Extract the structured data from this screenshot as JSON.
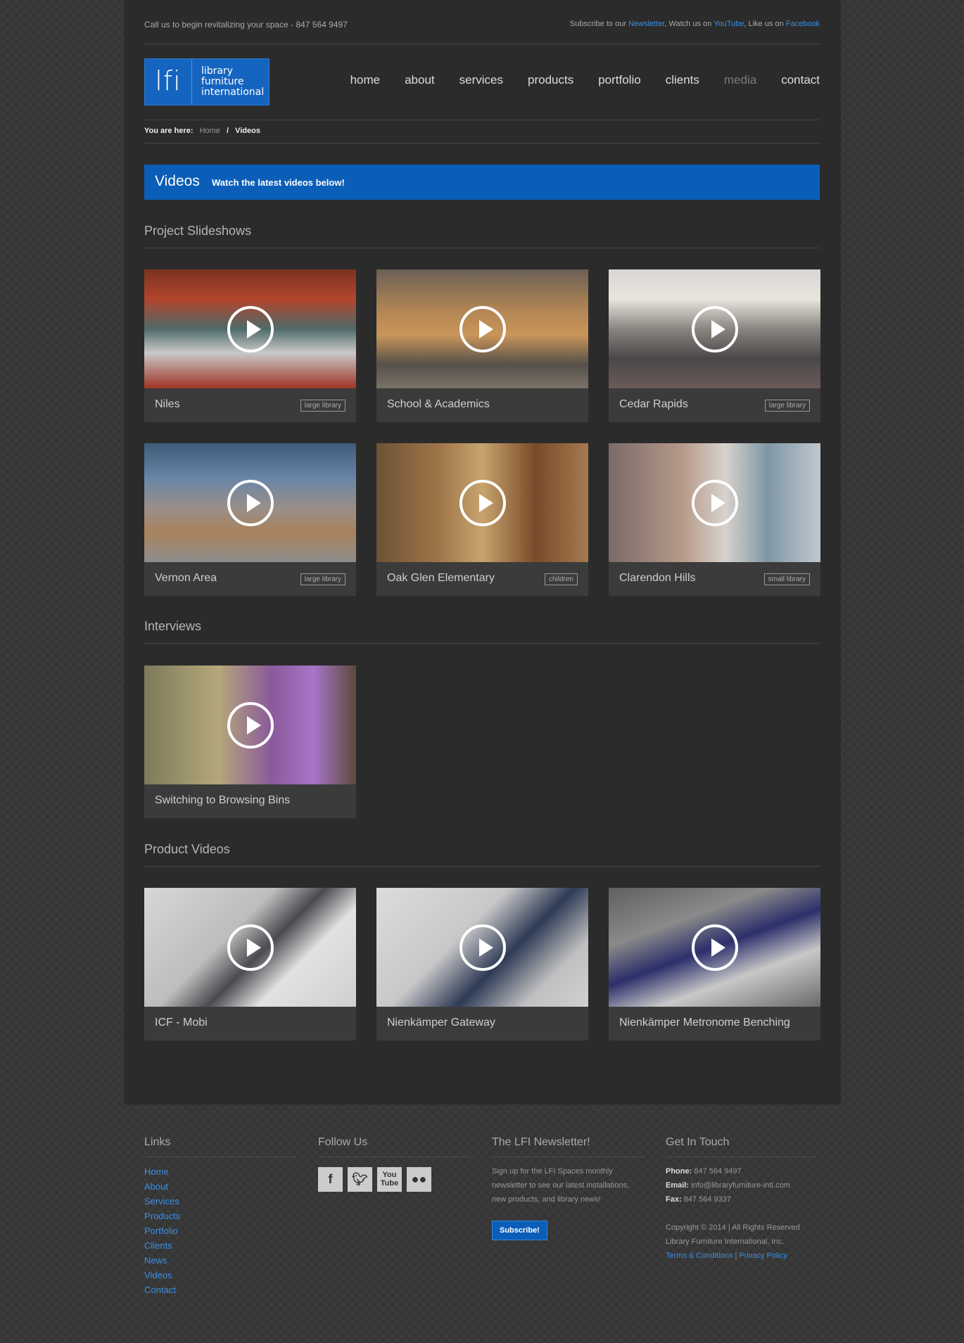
{
  "topbar": {
    "call": "Call us to begin revitalizing your space - 847 564 9497",
    "subscribe_prefix": "Subscribe to our",
    "newsletter": "Newsletter",
    "watch_prefix": ", Watch us on",
    "youtube": "YouTube",
    "like_prefix": ", Like us on",
    "facebook": "Facebook"
  },
  "logo": {
    "mark": "lfi",
    "line1": "library",
    "line2": "furniture",
    "line3": "international"
  },
  "nav": [
    "home",
    "about",
    "services",
    "products",
    "portfolio",
    "clients",
    "media",
    "contact"
  ],
  "breadcrumb": {
    "prefix": "You are here:",
    "home": "Home",
    "sep": "/",
    "current": "Videos"
  },
  "banner": {
    "title": "Videos",
    "subtitle": "Watch the latest videos below!"
  },
  "sections": {
    "slideshows": "Project Slideshows",
    "interviews": "Interviews",
    "products": "Product Videos"
  },
  "slideshows": [
    {
      "title": "Niles",
      "tag": "large library"
    },
    {
      "title": "School & Academics",
      "tag": ""
    },
    {
      "title": "Cedar Rapids",
      "tag": "large library"
    },
    {
      "title": "Vernon Area",
      "tag": "large library"
    },
    {
      "title": "Oak Glen Elementary",
      "tag": "children"
    },
    {
      "title": "Clarendon Hills",
      "tag": "small library"
    }
  ],
  "interviews": [
    {
      "title": "Switching to Browsing Bins"
    }
  ],
  "product_videos": [
    {
      "title": "ICF - Mobi"
    },
    {
      "title": "Nienkämper Gateway"
    },
    {
      "title": "Nienkämper Metronome Benching"
    }
  ],
  "footer": {
    "links_title": "Links",
    "links": [
      "Home",
      "About",
      "Services",
      "Products",
      "Portfolio",
      "Clients",
      "News",
      "Videos",
      "Contact"
    ],
    "follow_title": "Follow Us",
    "newsletter_title": "The LFI Newsletter!",
    "newsletter_text": "Sign up for the LFI Spaces monthly newsletter to see our latest installations, new products, and library news!",
    "subscribe_button": "Subscribe!",
    "contact_title": "Get In Touch",
    "phone_label": "Phone:",
    "phone": "847 564 9497",
    "email_label": "Email:",
    "email": "info@libraryfurniture-intl.com",
    "fax_label": "Fax:",
    "fax": "847 564 9337",
    "copyright": "Copyright © 2014 | All Rights Reserved",
    "company": "Library Furniture International, Inc.",
    "terms": "Terms & Conditions",
    "sep": "|",
    "privacy": "Privacy Policy"
  },
  "colors": {
    "accent": "#0a5eb8",
    "link": "#3a8fe6",
    "page_bg": "#2b2b2b"
  },
  "icons": [
    "play-icon",
    "facebook-icon",
    "twitter-icon",
    "youtube-icon",
    "flickr-icon"
  ]
}
